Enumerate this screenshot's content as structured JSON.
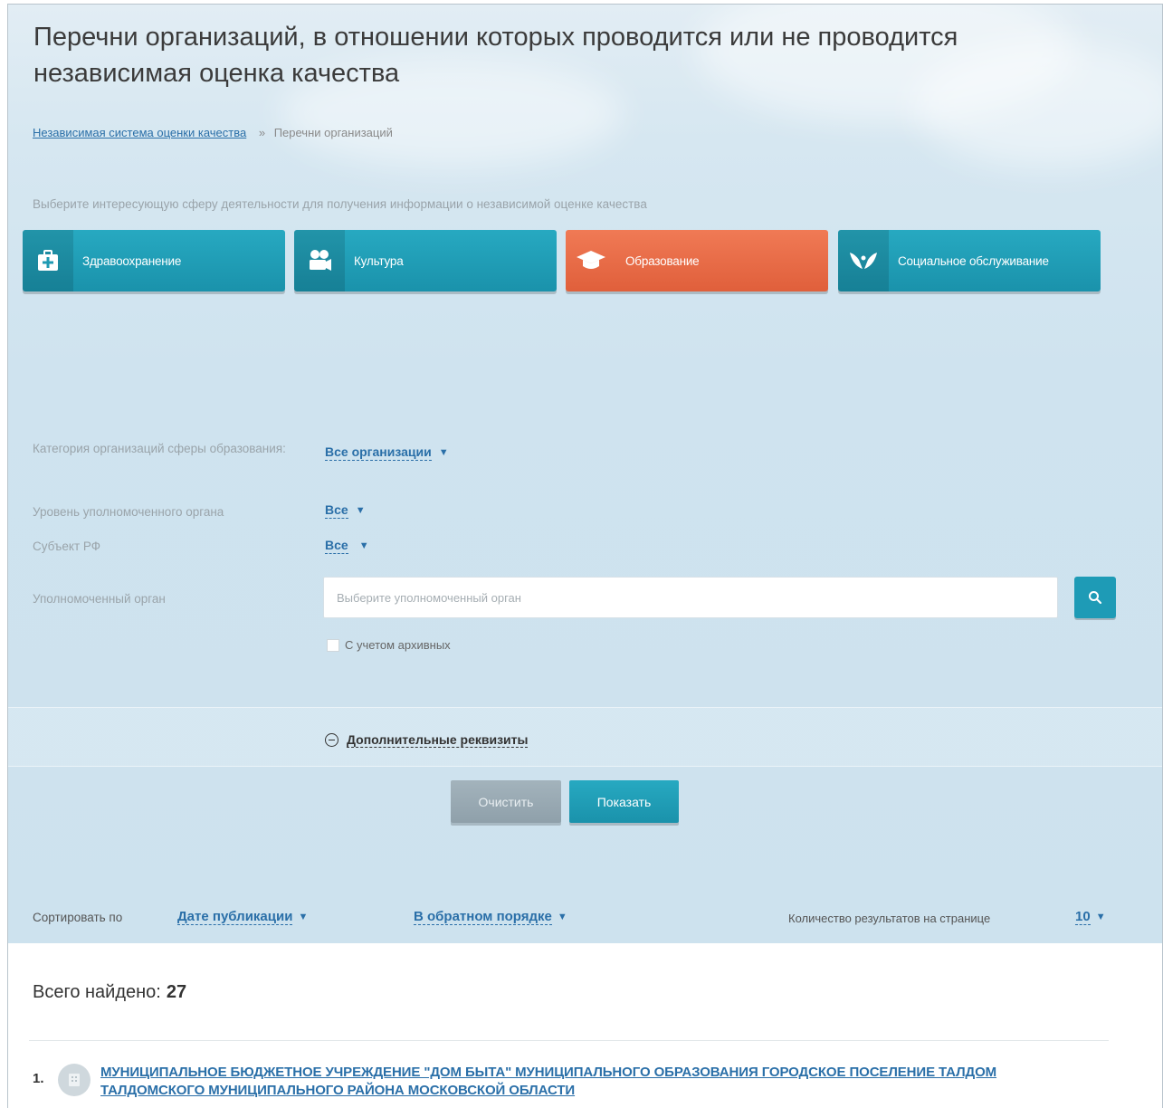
{
  "page": {
    "title": "Перечни организаций, в отношении которых проводится или не проводится независимая оценка качества"
  },
  "breadcrumb": {
    "root": "Независимая система оценки качества",
    "separator": "»",
    "current": "Перечни организаций"
  },
  "spheres": {
    "hint": "Выберите интересующую сферу деятельности для получения информации о независимой оценке качества",
    "items": [
      {
        "label": "Здравоохранение",
        "icon": "medkit-icon",
        "active": false
      },
      {
        "label": "Культура",
        "icon": "film-camera-icon",
        "active": false
      },
      {
        "label": "Образование",
        "icon": "graduation-cap-icon",
        "active": true
      },
      {
        "label": "Социальное обслуживание",
        "icon": "hands-icon",
        "active": false
      }
    ]
  },
  "filters": {
    "category_label": "Категория организаций сферы образования:",
    "category_value": "Все организации",
    "level_label": "Уровень уполномоченного органа",
    "level_value": "Все",
    "subject_label": "Субъект РФ",
    "subject_value": "Все",
    "authority_label": "Уполномоченный орган",
    "authority_placeholder": "Выберите уполномоченный орган",
    "archive_label": "С учетом архивных"
  },
  "extra": {
    "label": "Дополнительные реквизиты"
  },
  "actions": {
    "clear_label": "Очистить",
    "show_label": "Показать"
  },
  "sorting": {
    "label": "Сортировать по",
    "by_value": "Дате публикации",
    "order_value": "В обратном порядке",
    "per_page_label": "Количество результатов на странице",
    "per_page_value": "10"
  },
  "results": {
    "found_label": "Всего найдено:",
    "found_count": "27",
    "items": [
      {
        "num": "1.",
        "name": "МУНИЦИПАЛЬНОЕ БЮДЖЕТНОЕ УЧРЕЖДЕНИЕ \"ДОМ БЫТА\" МУНИЦИПАЛЬНОГО ОБРАЗОВАНИЯ ГОРОДСКОЕ ПОСЕЛЕНИЕ ТАЛДОМ ТАЛДОМСКОГО МУНИЦИПАЛЬНОГО РАЙОНА МОСКОВСКОЙ ОБЛАСТИ"
      }
    ]
  },
  "colors": {
    "teal": "#1e9bb6",
    "orange": "#e8694a",
    "link": "#2a6fa8"
  }
}
